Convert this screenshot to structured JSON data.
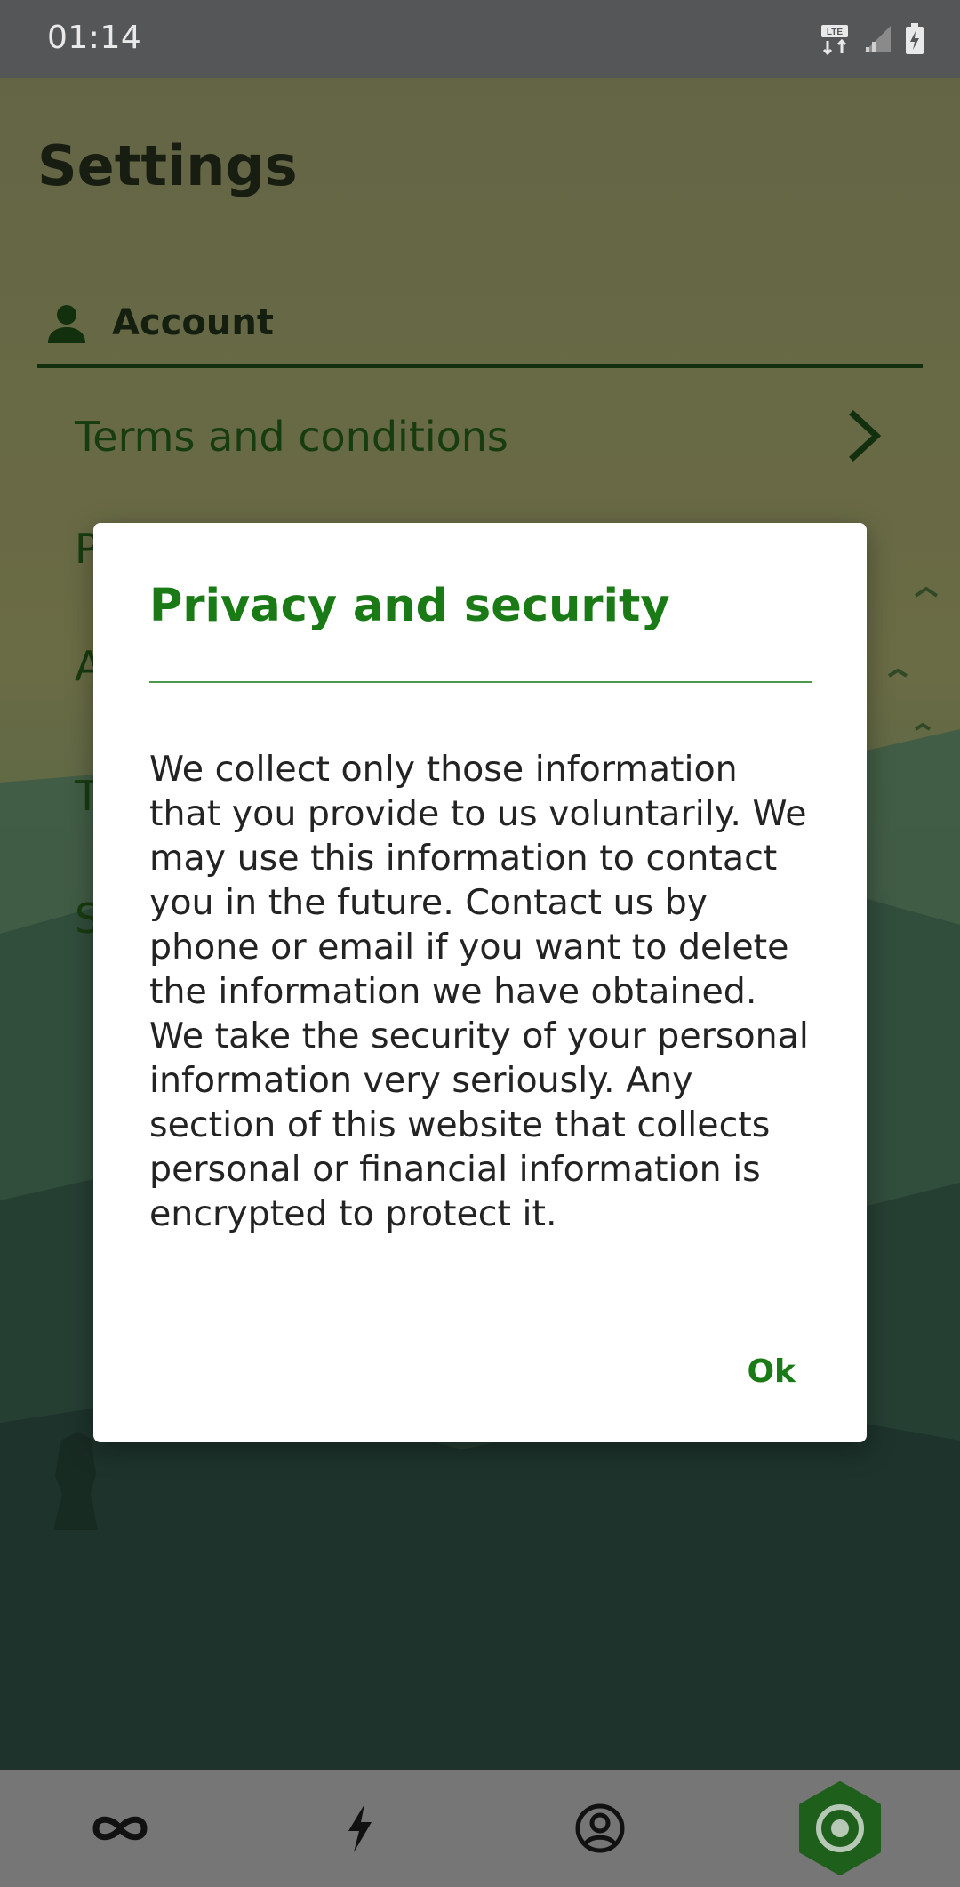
{
  "status_bar": {
    "time": "01:14",
    "icons": [
      "lte-data-icon",
      "signal-icon",
      "battery-charging-icon"
    ]
  },
  "page": {
    "title": "Settings"
  },
  "section": {
    "label": "Account",
    "icon": "person-icon"
  },
  "menu": {
    "items": [
      {
        "label": "Terms and conditions",
        "icon": "chevron-right-icon"
      },
      {
        "label": "P"
      },
      {
        "label": "A"
      },
      {
        "label": "T"
      },
      {
        "label": "S"
      }
    ]
  },
  "dialog": {
    "title": "Privacy and security",
    "body": "We collect only those information that you provide to us voluntarily. We may use this information to contact you in the future. Contact us by phone or email if you want to delete the information we have obtained. We take the security of your personal information very seriously. Any section of this website that collects personal or financial information is encrypted to protect it.",
    "ok_label": "Ok"
  },
  "bottom_nav": {
    "items": [
      {
        "icon": "infinity-icon",
        "active": false
      },
      {
        "icon": "lightning-icon",
        "active": false
      },
      {
        "icon": "account-circle-icon",
        "active": false
      },
      {
        "icon": "settings-target-icon",
        "active": true
      }
    ]
  },
  "colors": {
    "accent_green": "#1a7a16",
    "dark_green": "#173a12",
    "status_bar": "#555657",
    "bottom_nav": "#767676"
  }
}
